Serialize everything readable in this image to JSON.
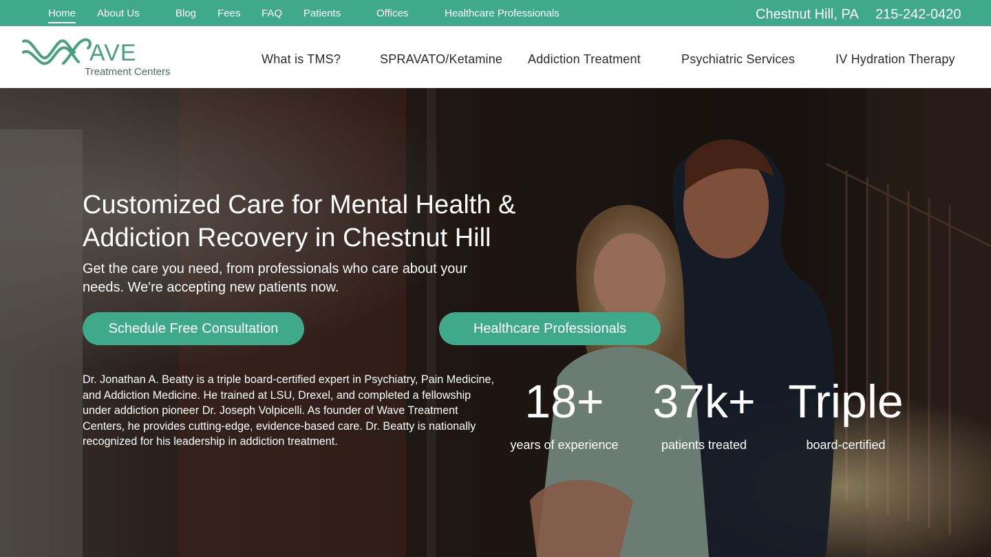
{
  "topbar": {
    "nav": [
      {
        "label": "Home",
        "active": true
      },
      {
        "label": "About Us"
      },
      {
        "label": "Blog"
      },
      {
        "label": "Fees"
      },
      {
        "label": "FAQ"
      },
      {
        "label": "Patients"
      },
      {
        "label": "Offices"
      },
      {
        "label": "Healthcare Professionals"
      }
    ],
    "location": "Chestnut Hill, PA",
    "phone": "215-242-0420"
  },
  "header": {
    "logo_text": "AVE",
    "logo_subtitle": "Treatment Centers",
    "nav": [
      {
        "label": "What is TMS?"
      },
      {
        "label": "SPRAVATO/Ketamine"
      },
      {
        "label": "Addiction Treatment"
      },
      {
        "label": "Psychiatric Services"
      },
      {
        "label": "IV Hydration Therapy"
      }
    ]
  },
  "hero": {
    "title": "Customized Care for Mental Health & Addiction Recovery in Chestnut Hill",
    "subtitle": "Get the care you need, from professionals who care about your needs. We're accepting new patients now.",
    "primary_button": "Schedule Free Consultation",
    "secondary_button": "Healthcare Professionals",
    "bio": "Dr. Jonathan A. Beatty is a triple board-certified expert in Psychiatry, Pain Medicine, and Addiction Medicine. He trained at LSU, Drexel, and completed a fellowship under addiction pioneer Dr. Joseph Volpicelli. As founder of Wave Treatment Centers, he provides cutting-edge, evidence-based care. Dr. Beatty is nationally recognized for his leadership in addiction treatment.",
    "stats": [
      {
        "value": "18+",
        "label": "years of experience"
      },
      {
        "value": "37k+",
        "label": "patients treated"
      },
      {
        "value": "Triple",
        "label": "board-certified"
      }
    ]
  },
  "colors": {
    "brand_green": "#3fa98a",
    "logo_green": "#4a9e82",
    "header_bg": "#ffffff",
    "nav_text": "#2a2a2a"
  }
}
